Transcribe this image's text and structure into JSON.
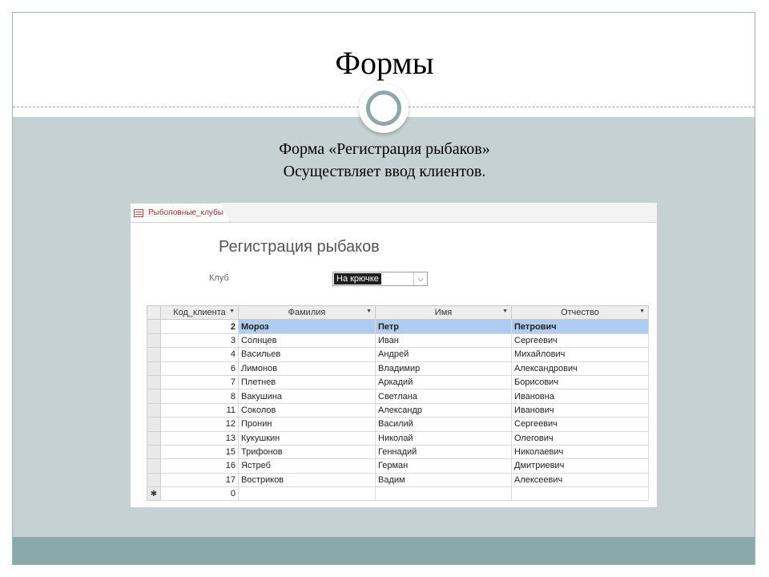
{
  "slide": {
    "title": "Формы",
    "subtitle_line1": "Форма «Регистрация рыбаков»",
    "subtitle_line2": "Осуществляет ввод клиентов."
  },
  "window": {
    "tab_label": "Рыболовные_клубы",
    "form_title": "Регистрация рыбаков",
    "club_label": "Клуб",
    "club_value": "На крючке"
  },
  "table": {
    "columns": [
      "Код_клиента",
      "Фамилия",
      "Имя",
      "Отчество"
    ],
    "rows": [
      {
        "id": "2",
        "last": "Мороз",
        "first": "Петр",
        "middle": "Петрович"
      },
      {
        "id": "3",
        "last": "Солнцев",
        "first": "Иван",
        "middle": "Сергеевич"
      },
      {
        "id": "4",
        "last": "Васильев",
        "first": "Андрей",
        "middle": "Михайлович"
      },
      {
        "id": "6",
        "last": "Лимонов",
        "first": "Владимир",
        "middle": "Александрович"
      },
      {
        "id": "7",
        "last": "Плетнев",
        "first": "Аркадий",
        "middle": "Борисович"
      },
      {
        "id": "8",
        "last": "Вакушина",
        "first": "Светлана",
        "middle": "Ивановна"
      },
      {
        "id": "11",
        "last": "Соколов",
        "first": "Александр",
        "middle": "Иванович"
      },
      {
        "id": "12",
        "last": "Пронин",
        "first": "Василий",
        "middle": "Сергеевич"
      },
      {
        "id": "13",
        "last": "Кукушкин",
        "first": "Николай",
        "middle": "Олегович"
      },
      {
        "id": "15",
        "last": "Трифонов",
        "first": "Геннадий",
        "middle": "Николаевич"
      },
      {
        "id": "16",
        "last": "Ястреб",
        "first": "Герман",
        "middle": "Дмитриевич"
      },
      {
        "id": "17",
        "last": "Востриков",
        "first": "Вадим",
        "middle": "Алексеевич"
      }
    ],
    "new_row_id": "0"
  }
}
